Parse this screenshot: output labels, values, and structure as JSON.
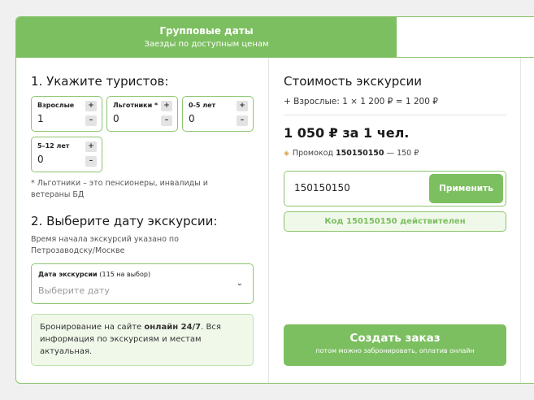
{
  "tabs": {
    "active_title": "Групповые даты",
    "active_subtitle": "Заезды по доступным ценам"
  },
  "tourists": {
    "heading": "1. Укажите туристов:",
    "counters": [
      {
        "label": "Взрослые",
        "value": "1"
      },
      {
        "label": "Льготники *",
        "value": "0"
      },
      {
        "label": "0-5 лет",
        "value": "0"
      },
      {
        "label": "5–12 лет",
        "value": "0"
      }
    ],
    "plus_symbol": "+",
    "minus_symbol": "–",
    "footnote": "* Льготники – это пенсионеры, инвалиды и ветераны БД"
  },
  "date": {
    "heading": "2. Выберите дату экскурсии:",
    "note": "Время начала экскурсий указано по Петрозаводску/Москве",
    "select_label": "Дата экскурсии",
    "select_count": "(115 на выбор)",
    "select_placeholder": "Выберите дату",
    "chevron": "⌄",
    "info_pre": "Бронирование на сайте ",
    "info_bold": "онлайн 24/7",
    "info_post": ". Вся информация по экскурсиям и местам актуальная."
  },
  "cost": {
    "heading": "Стоимость экскурсии",
    "adults_line": "+ Взрослые: 1 × 1 200 ₽ = 1 200 ₽",
    "big_price": "1 050 ₽ за 1 чел.",
    "promo_prefix": "Промокод ",
    "promo_code": "150150150",
    "promo_discount": " — 150 ₽",
    "promo_input_value": "150150150",
    "apply_label": "Применить",
    "valid_pre": "Код ",
    "valid_code": "150150150",
    "valid_post": " действителен",
    "order_label": "Создать заказ",
    "order_sub": "потом можно забронировать, оплатив онлайн"
  },
  "colors": {
    "accent": "#7cbf60",
    "border": "#8cc56f",
    "info_bg": "#f0f8ea"
  }
}
